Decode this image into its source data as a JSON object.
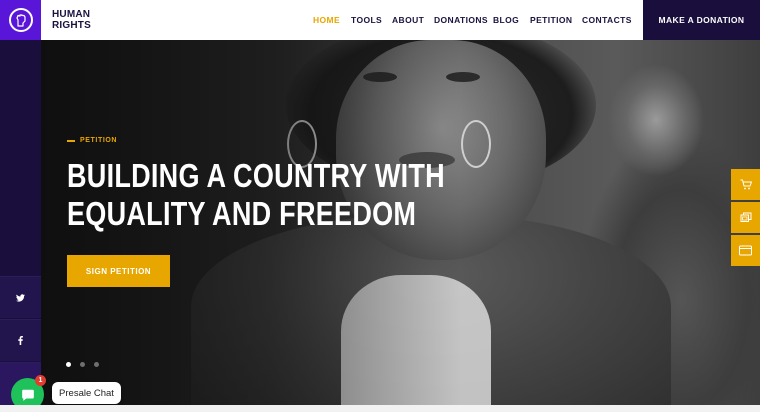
{
  "brand": {
    "name_line1": "HUMAN",
    "name_line2": "RIGHTS",
    "logo_icon": "raised-fist-icon",
    "logo_color": "#5a16d8"
  },
  "nav": {
    "items": [
      {
        "label": "HOME",
        "active": true
      },
      {
        "label": "TOOLS",
        "active": false
      },
      {
        "label": "ABOUT",
        "active": false
      },
      {
        "label": "DONATIONS",
        "active": false
      },
      {
        "label": "BLOG",
        "active": false
      },
      {
        "label": "PETITION",
        "active": false
      },
      {
        "label": "CONTACTS",
        "active": false
      }
    ],
    "cta_label": "MAKE A DONATION"
  },
  "hero": {
    "eyebrow": "PETITION",
    "headline_line1": "BUILDING A COUNTRY WITH",
    "headline_line2": "EQUALITY AND FREEDOM",
    "button_label": "SIGN PETITION",
    "slide_count": 3,
    "active_slide": 1
  },
  "social": {
    "items": [
      {
        "icon": "twitter-icon",
        "glyph": "𝕥"
      },
      {
        "icon": "facebook-icon",
        "glyph": "f"
      }
    ]
  },
  "side_tabs": [
    {
      "icon": "cart-icon"
    },
    {
      "icon": "layers-icon"
    },
    {
      "icon": "browser-window-icon"
    }
  ],
  "chat": {
    "label": "Presale Chat",
    "badge_count": "1"
  },
  "colors": {
    "accent": "#e8a600",
    "navy": "#1a0f3c",
    "chat_green": "#1ec15a"
  }
}
